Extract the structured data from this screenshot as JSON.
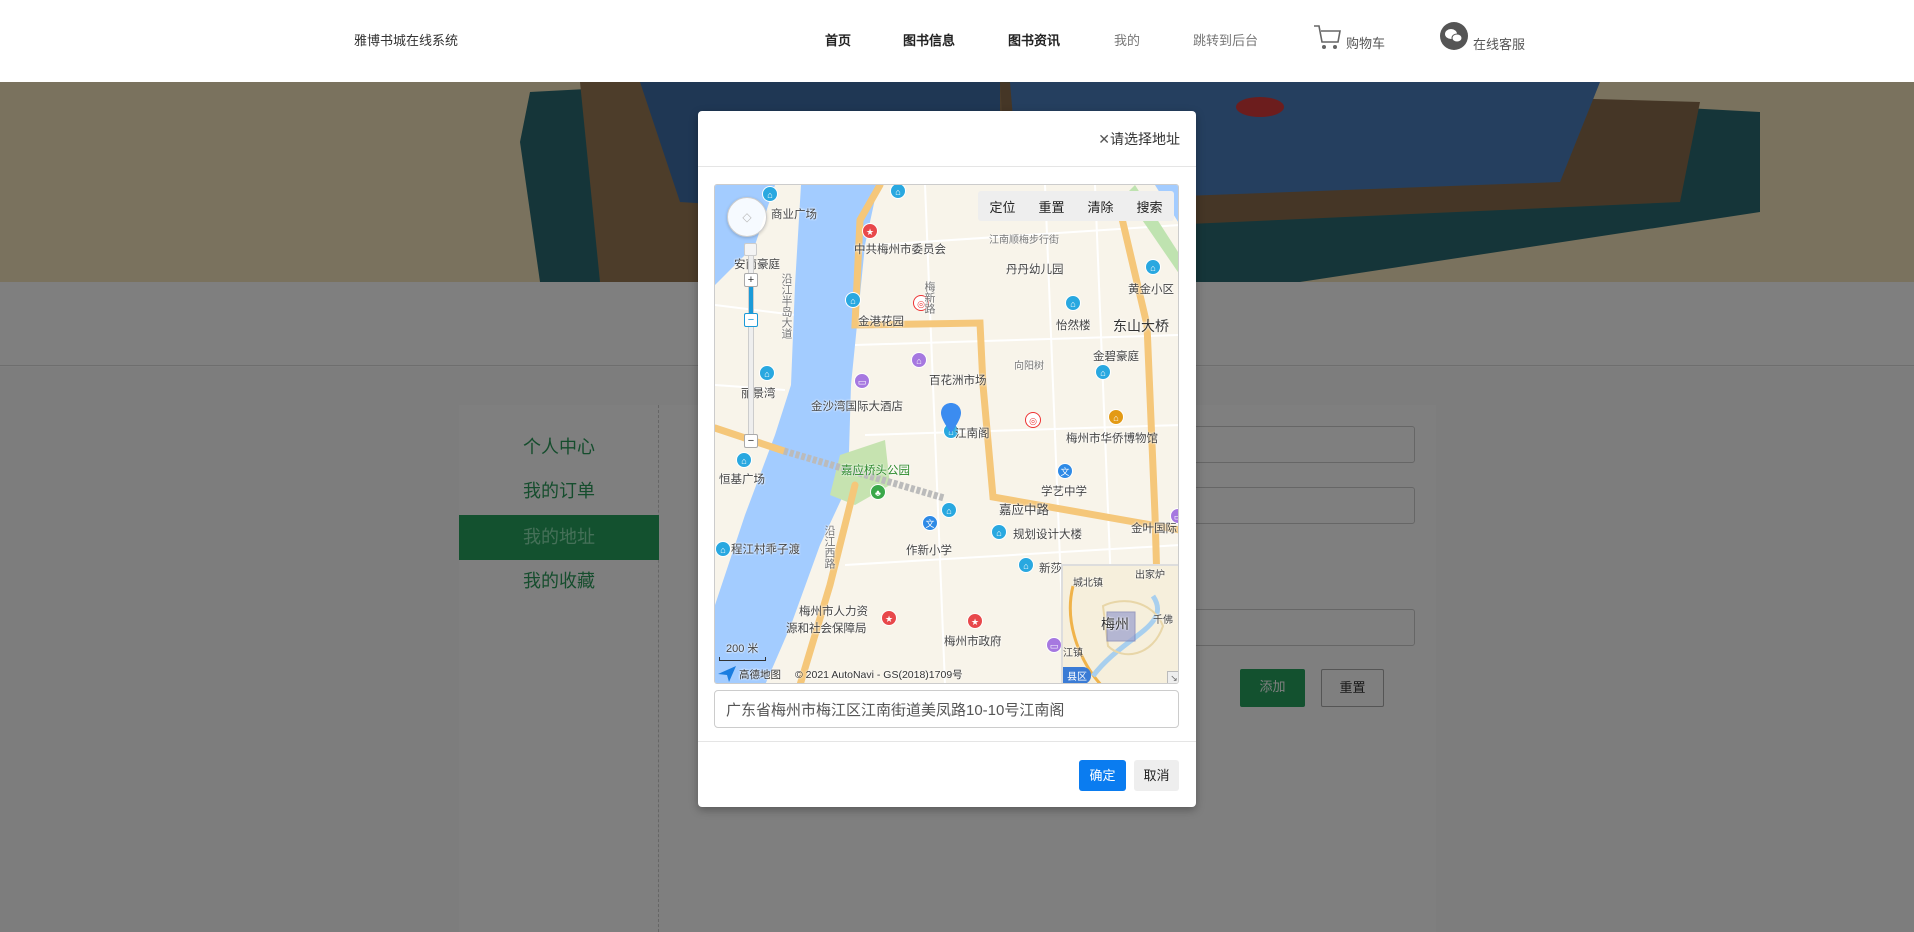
{
  "header": {
    "brand": "雅博书城在线系统",
    "nav": [
      "首页",
      "图书信息",
      "图书资讯",
      "我的",
      "跳转到后台"
    ],
    "cart_label": "购物车",
    "service_label": "在线客服"
  },
  "sidebar": {
    "items": [
      {
        "label": "个人中心"
      },
      {
        "label": "我的订单"
      },
      {
        "label": "我的地址",
        "active": true
      },
      {
        "label": "我的收藏"
      }
    ]
  },
  "form": {
    "add_label": "添加",
    "reset_label": "重置"
  },
  "modal": {
    "title": "请选择地址",
    "address_value": "广东省梅州市梅江区江南街道美凤路10-10号江南阁",
    "confirm_label": "确定",
    "cancel_label": "取消"
  },
  "map": {
    "toolbar": [
      "定位",
      "重置",
      "清除",
      "搜索"
    ],
    "labels": [
      "商业广场",
      "中共梅州市委员会",
      "江南顺梅步行街",
      "丹丹幼儿园",
      "黄金小区",
      "梅新路",
      "金港花园",
      "怡然楼",
      "东山大桥",
      "金碧豪庭",
      "向阳树",
      "百花洲市场",
      "金沙湾国际大酒店",
      "江南阁",
      "梅州市华侨博物馆",
      "丽景湾",
      "恒基广场",
      "嘉应桥头公园",
      "学艺中学",
      "嘉应中路",
      "安南豪庭",
      "沿江半岛大道",
      "金叶国际",
      "规划设计大楼",
      "程江村乖子渡",
      "作新小学",
      "沿江西路",
      "梅州市人力资",
      "源和社会保障局",
      "梅州市政府",
      "新莎"
    ],
    "scale": "200 米",
    "provider": "高德地图",
    "attribution": "© 2021 AutoNavi - GS(2018)1709号",
    "minimap_labels": [
      "城北镇",
      "出家炉",
      "梅州",
      "千佛",
      "江镇",
      "县区"
    ],
    "colors": {
      "water": "#a3ccff",
      "road": "#f5c77a",
      "land": "#f8f4ea",
      "marker": "#3b8cf0"
    }
  }
}
